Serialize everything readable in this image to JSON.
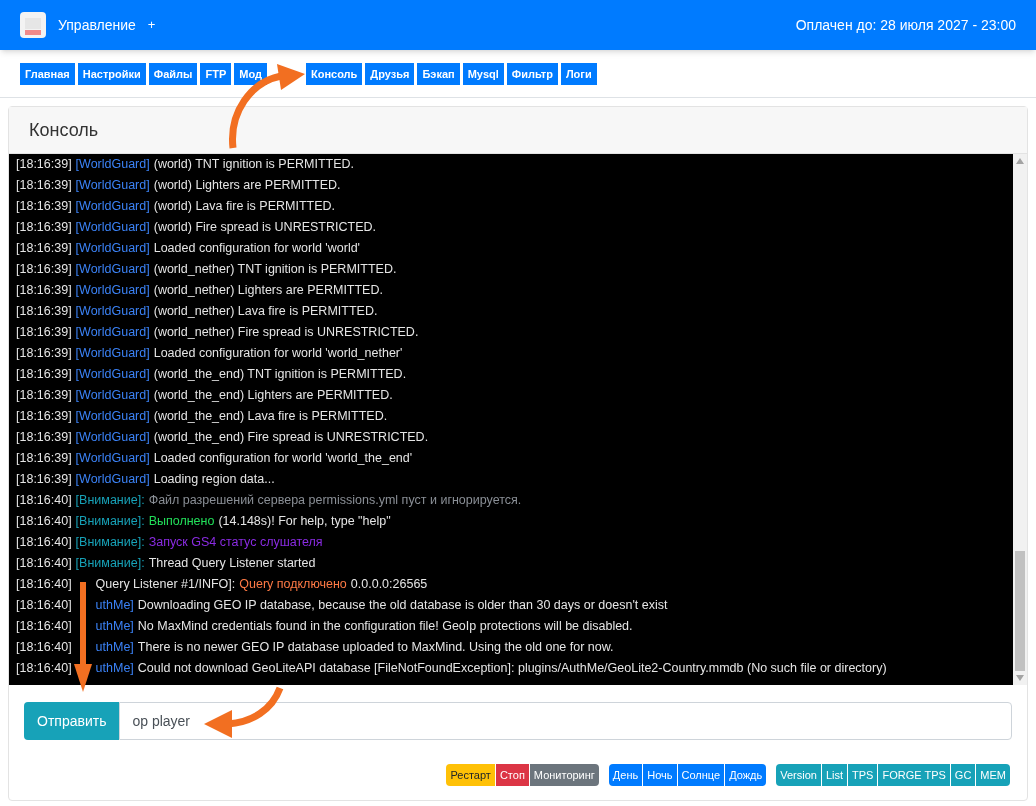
{
  "header": {
    "title": "Управление",
    "plus": "+",
    "paid_until": "Оплачен до: 28 июля 2027 - 23:00"
  },
  "tabs": [
    {
      "label": "Главная",
      "kind": "plain"
    },
    {
      "label": "Настройки",
      "kind": "plain"
    },
    {
      "label": "Файлы",
      "kind": "plain"
    },
    {
      "label": "FTP",
      "kind": "plain"
    },
    {
      "label": "Мод",
      "kind": "covered"
    },
    {
      "label": "Консоль",
      "kind": "plain"
    },
    {
      "label": "Друзья",
      "kind": "plain"
    },
    {
      "label": "Бэкап",
      "kind": "plain"
    },
    {
      "label": "Mysql",
      "kind": "plain"
    },
    {
      "label": "Фильтр",
      "kind": "plain"
    },
    {
      "label": "Логи",
      "kind": "plain"
    }
  ],
  "card": {
    "title": "Консоль"
  },
  "console": [
    [
      {
        "text": "[18:16:39]",
        "kind": "time"
      },
      {
        "text": "[WorldGuard]",
        "kind": "tag"
      },
      {
        "text": "(world) TNT ignition is PERMITTED.",
        "kind": "text"
      }
    ],
    [
      {
        "text": "[18:16:39]",
        "kind": "time"
      },
      {
        "text": "[WorldGuard]",
        "kind": "tag"
      },
      {
        "text": "(world) Lighters are PERMITTED.",
        "kind": "text"
      }
    ],
    [
      {
        "text": "[18:16:39]",
        "kind": "time"
      },
      {
        "text": "[WorldGuard]",
        "kind": "tag"
      },
      {
        "text": "(world) Lava fire is PERMITTED.",
        "kind": "text"
      }
    ],
    [
      {
        "text": "[18:16:39]",
        "kind": "time"
      },
      {
        "text": "[WorldGuard]",
        "kind": "tag"
      },
      {
        "text": "(world) Fire spread is UNRESTRICTED.",
        "kind": "text"
      }
    ],
    [
      {
        "text": "[18:16:39]",
        "kind": "time"
      },
      {
        "text": "[WorldGuard]",
        "kind": "tag"
      },
      {
        "text": "Loaded configuration for world 'world'",
        "kind": "text"
      }
    ],
    [
      {
        "text": "[18:16:39]",
        "kind": "time"
      },
      {
        "text": "[WorldGuard]",
        "kind": "tag"
      },
      {
        "text": "(world_nether) TNT ignition is PERMITTED.",
        "kind": "text"
      }
    ],
    [
      {
        "text": "[18:16:39]",
        "kind": "time"
      },
      {
        "text": "[WorldGuard]",
        "kind": "tag"
      },
      {
        "text": "(world_nether) Lighters are PERMITTED.",
        "kind": "text"
      }
    ],
    [
      {
        "text": "[18:16:39]",
        "kind": "time"
      },
      {
        "text": "[WorldGuard]",
        "kind": "tag"
      },
      {
        "text": "(world_nether) Lava fire is PERMITTED.",
        "kind": "text"
      }
    ],
    [
      {
        "text": "[18:16:39]",
        "kind": "time"
      },
      {
        "text": "[WorldGuard]",
        "kind": "tag"
      },
      {
        "text": "(world_nether) Fire spread is UNRESTRICTED.",
        "kind": "text"
      }
    ],
    [
      {
        "text": "[18:16:39]",
        "kind": "time"
      },
      {
        "text": "[WorldGuard]",
        "kind": "tag"
      },
      {
        "text": "Loaded configuration for world 'world_nether'",
        "kind": "text"
      }
    ],
    [
      {
        "text": "[18:16:39]",
        "kind": "time"
      },
      {
        "text": "[WorldGuard]",
        "kind": "tag"
      },
      {
        "text": "(world_the_end) TNT ignition is PERMITTED.",
        "kind": "text"
      }
    ],
    [
      {
        "text": "[18:16:39]",
        "kind": "time"
      },
      {
        "text": "[WorldGuard]",
        "kind": "tag"
      },
      {
        "text": "(world_the_end) Lighters are PERMITTED.",
        "kind": "text"
      }
    ],
    [
      {
        "text": "[18:16:39]",
        "kind": "time"
      },
      {
        "text": "[WorldGuard]",
        "kind": "tag"
      },
      {
        "text": "(world_the_end) Lava fire is PERMITTED.",
        "kind": "text"
      }
    ],
    [
      {
        "text": "[18:16:39]",
        "kind": "time"
      },
      {
        "text": "[WorldGuard]",
        "kind": "tag"
      },
      {
        "text": "(world_the_end) Fire spread is UNRESTRICTED.",
        "kind": "text"
      }
    ],
    [
      {
        "text": "[18:16:39]",
        "kind": "time"
      },
      {
        "text": "[WorldGuard]",
        "kind": "tag"
      },
      {
        "text": "Loaded configuration for world 'world_the_end'",
        "kind": "text"
      }
    ],
    [
      {
        "text": "[18:16:39]",
        "kind": "time"
      },
      {
        "text": "[WorldGuard]",
        "kind": "tag"
      },
      {
        "text": "Loading region data...",
        "kind": "text"
      }
    ],
    [
      {
        "text": "[18:16:40]",
        "kind": "time"
      },
      {
        "text": "[Внимание]:",
        "kind": "warn"
      },
      {
        "text": "Файл разрешений сервера permissions.yml пуст и игнорируется.",
        "kind": "muted"
      }
    ],
    [
      {
        "text": "[18:16:40]",
        "kind": "time"
      },
      {
        "text": "[Внимание]:",
        "kind": "warn"
      },
      {
        "text": "Выполнено",
        "kind": "success"
      },
      {
        "text": "(14.148s)! For help, type \"help\"",
        "kind": "text"
      }
    ],
    [
      {
        "text": "[18:16:40]",
        "kind": "time"
      },
      {
        "text": "[Внимание]:",
        "kind": "warn"
      },
      {
        "text": "Запуск GS4 статус слушателя",
        "kind": "purple"
      }
    ],
    [
      {
        "text": "[18:16:40]",
        "kind": "time"
      },
      {
        "text": "[Внимание]:",
        "kind": "warn"
      },
      {
        "text": "Thread Query Listener started",
        "kind": "text"
      }
    ],
    [
      {
        "text": "[18:16:40]",
        "kind": "time"
      },
      {
        "text": "Query Listener #1/INFO]:",
        "kind": "text_cut"
      },
      {
        "text": "Query подключено",
        "kind": "orange"
      },
      {
        "text": "0.0.0.0:26565",
        "kind": "text"
      }
    ],
    [
      {
        "text": "[18:16:40]",
        "kind": "time"
      },
      {
        "text": "uthMe]",
        "kind": "tag_cut"
      },
      {
        "text": "Downloading GEO IP database, because the old database is older than 30 days or doesn't exist",
        "kind": "text"
      }
    ],
    [
      {
        "text": "[18:16:40]",
        "kind": "time"
      },
      {
        "text": "uthMe]",
        "kind": "tag_cut"
      },
      {
        "text": "No MaxMind credentials found in the configuration file! GeoIp protections will be disabled.",
        "kind": "text"
      }
    ],
    [
      {
        "text": "[18:16:40]",
        "kind": "time"
      },
      {
        "text": "uthMe]",
        "kind": "tag_cut"
      },
      {
        "text": "There is no newer GEO IP database uploaded to MaxMind. Using the old one for now.",
        "kind": "text"
      }
    ],
    [
      {
        "text": "[18:16:40]",
        "kind": "time"
      },
      {
        "text": "uthMe]",
        "kind": "tag_cut"
      },
      {
        "text": "Could not download GeoLiteAPI database [FileNotFoundException]: plugins/AuthMe/GeoLite2-Country.mmdb (No such file or directory)",
        "kind": "text"
      }
    ]
  ],
  "command": {
    "button": "Отправить",
    "value": "op player"
  },
  "button_groups": [
    [
      {
        "label": "Рестарт",
        "kind": "warning"
      },
      {
        "label": "Стоп",
        "kind": "danger"
      },
      {
        "label": "Мониторинг",
        "kind": "secondary"
      }
    ],
    [
      {
        "label": "День",
        "kind": "primary"
      },
      {
        "label": "Ночь",
        "kind": "primary"
      },
      {
        "label": "Солнце",
        "kind": "primary"
      },
      {
        "label": "Дождь",
        "kind": "primary"
      }
    ],
    [
      {
        "label": "Version",
        "kind": "info"
      },
      {
        "label": "List",
        "kind": "info"
      },
      {
        "label": "TPS",
        "kind": "info"
      },
      {
        "label": "FORGE TPS",
        "kind": "info"
      },
      {
        "label": "GC",
        "kind": "info"
      },
      {
        "label": "MEM",
        "kind": "info"
      }
    ]
  ]
}
